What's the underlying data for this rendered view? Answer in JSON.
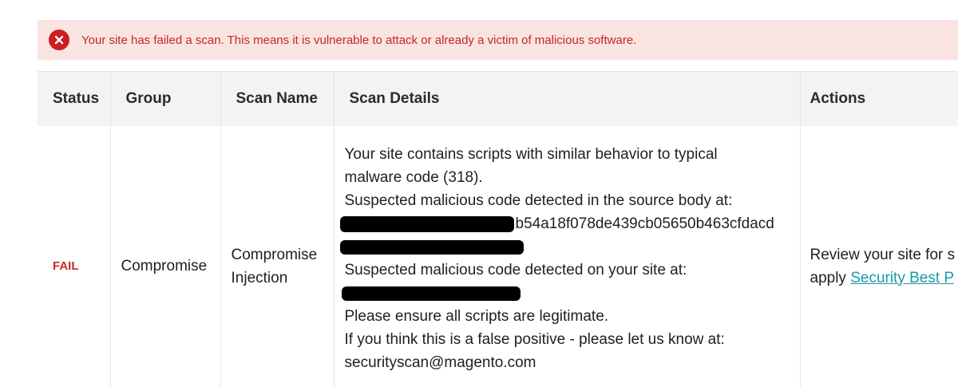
{
  "alert": {
    "icon": "error-x-icon",
    "color": "#cc1f1f",
    "text": "Your site has failed a scan. This means it is vulnerable to attack or already a victim of malicious software."
  },
  "table": {
    "headers": {
      "status": "Status",
      "group": "Group",
      "scan_name": "Scan Name",
      "scan_details": "Scan Details",
      "actions": "Actions"
    },
    "row": {
      "status": "FAIL",
      "group": "Compromise",
      "scan_name_line1": "Compromise",
      "scan_name_line2": "Injection",
      "details": {
        "line1": "Your site contains scripts with similar behavior to typical",
        "line2": "malware code (318).",
        "line3": "Suspected malicious code detected in the source body at:",
        "line4_visible": "b54a18f078de439cb05650b463cfdacd",
        "line6": "Suspected malicious code detected on your site at:",
        "line8": "Please ensure all scripts are legitimate.",
        "line9": "If you think this is a false positive - please let us know at:",
        "line10": "securityscan@magento.com"
      },
      "actions_line1": "Review your site for s",
      "actions_line2_prefix": "apply ",
      "actions_link": "Security Best P"
    }
  }
}
